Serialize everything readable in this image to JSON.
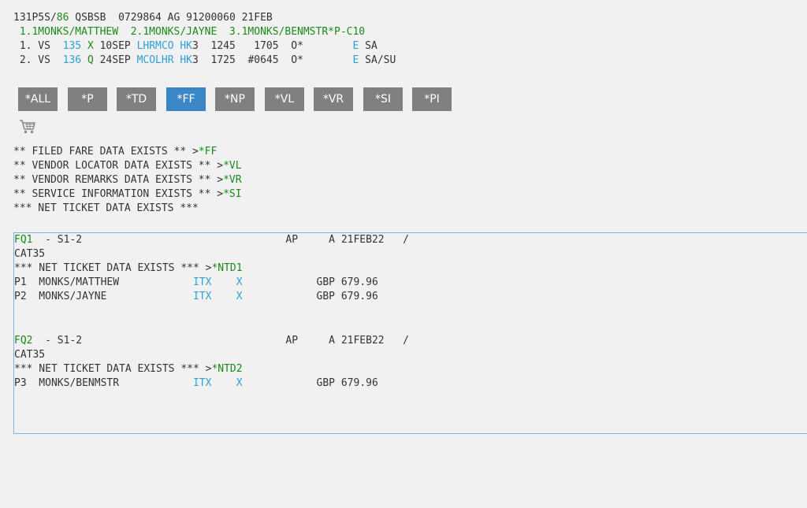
{
  "header": {
    "rec_prefix": "131P5S/",
    "rec_num": "86",
    "rec_rest": " QSBSB  0729864 AG 91200060 21FEB"
  },
  "names_line": " 1.1MONKS/MATTHEW  2.1MONKS/JAYNE  3.1MONKS/BENMSTR*P-C10",
  "segments": [
    {
      "num": " 1. VS  ",
      "flt": "135",
      "cls": "X",
      "date": " 10SEP ",
      "route": "LHRMCO",
      "status": "HK",
      "qty": "3  1245   1705  O*        ",
      "e": "E",
      "days": " SA"
    },
    {
      "num": " 2. VS  ",
      "flt": "136",
      "cls": "Q",
      "date": " 24SEP ",
      "route": "MCOLHR",
      "status": "HK",
      "qty": "3  1725  #0645  O*        ",
      "e": "E",
      "days": " SA/SU"
    }
  ],
  "buttons": [
    "*ALL",
    "*P",
    "*TD",
    "*FF",
    "*NP",
    "*VL",
    "*VR",
    "*SI",
    "*PI"
  ],
  "active_button": "*FF",
  "messages": [
    {
      "text": "** FILED FARE DATA EXISTS ** >",
      "cmd": "*FF"
    },
    {
      "text": "** VENDOR LOCATOR DATA EXISTS ** >",
      "cmd": "*VL"
    },
    {
      "text": "** VENDOR REMARKS DATA EXISTS ** >",
      "cmd": "*VR"
    },
    {
      "text": "** SERVICE INFORMATION EXISTS ** >",
      "cmd": "*SI"
    },
    {
      "text": "*** NET TICKET DATA EXISTS ***",
      "cmd": ""
    }
  ],
  "fares": [
    {
      "id": "FQ1",
      "seg": "  - S1-2                                 AP     A 21FEB22   /",
      "cat": "CAT35",
      "net_text": "*** NET TICKET DATA EXISTS *** >",
      "net_cmd": "*NTD1",
      "passengers": [
        {
          "pre": "P1  MONKS/MATTHEW            ",
          "type": "ITX",
          "sp": "    ",
          "flag": "X",
          "amt": "            GBP 679.96"
        },
        {
          "pre": "P2  MONKS/JAYNE              ",
          "type": "ITX",
          "sp": "    ",
          "flag": "X",
          "amt": "            GBP 679.96"
        }
      ]
    },
    {
      "id": "FQ2",
      "seg": "  - S1-2                                 AP     A 21FEB22   /",
      "cat": "CAT35",
      "net_text": "*** NET TICKET DATA EXISTS *** >",
      "net_cmd": "*NTD2",
      "passengers": [
        {
          "pre": "P3  MONKS/BENMSTR            ",
          "type": "ITX",
          "sp": "    ",
          "flag": "X",
          "amt": "            GBP 679.96"
        }
      ]
    }
  ],
  "colors": {
    "green": "#1a8a1a",
    "blue": "#2f9fd6",
    "button": "#808080",
    "button_active": "#3b86c6"
  },
  "icons": {
    "cart": "shopping-cart-icon"
  }
}
